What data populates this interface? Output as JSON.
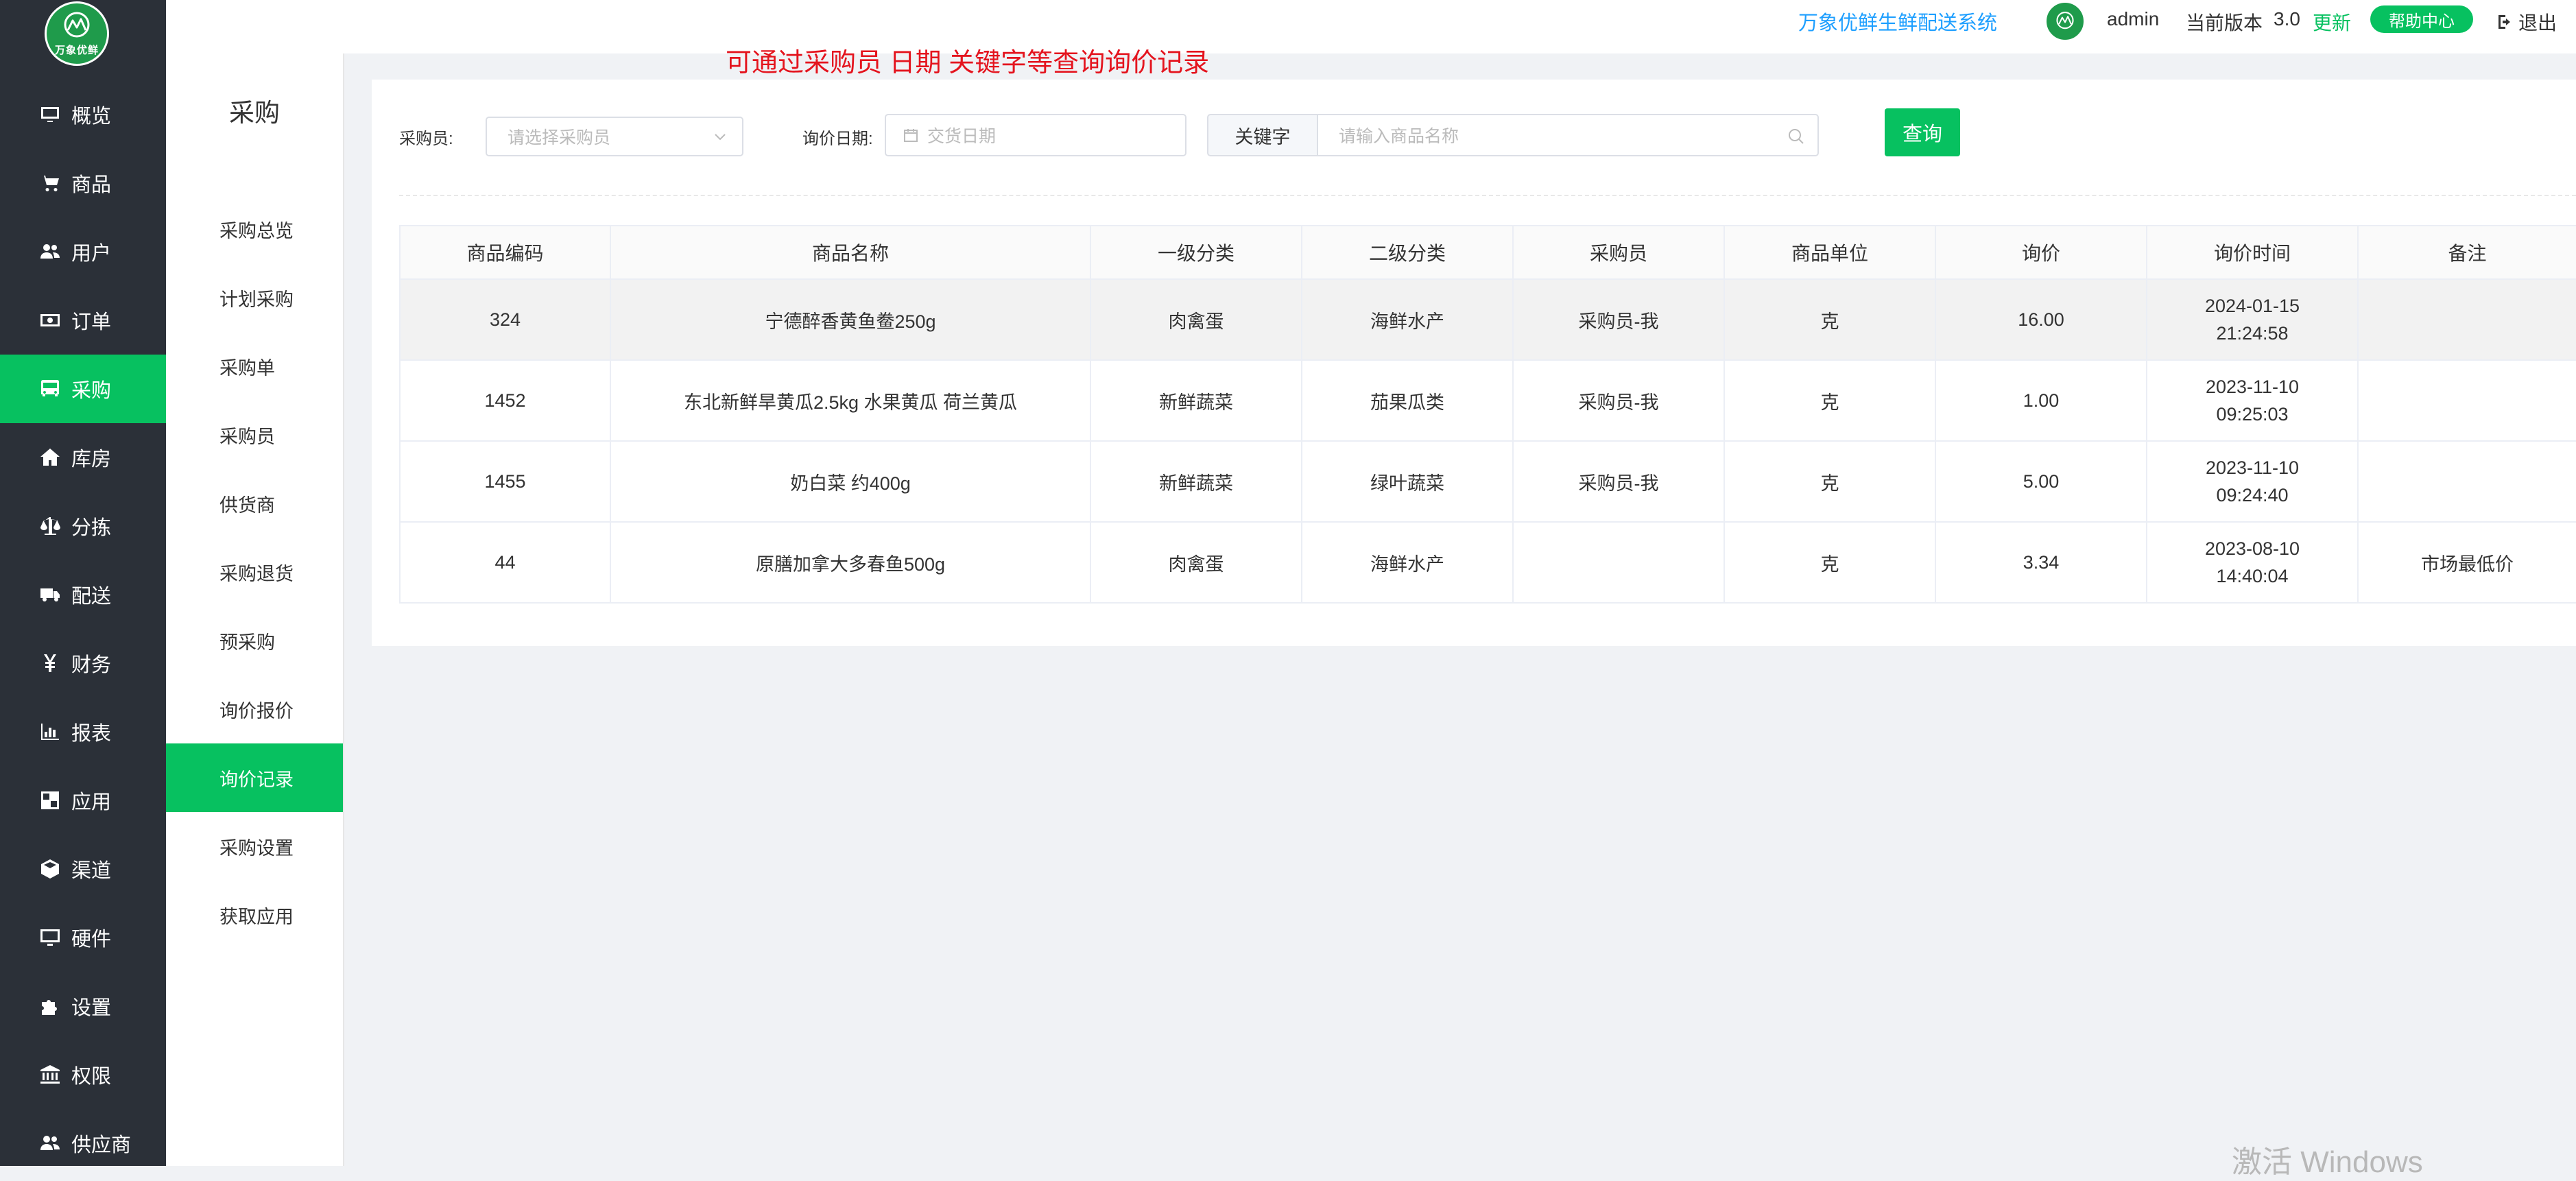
{
  "logo": {
    "text": "万象优鲜"
  },
  "nav": {
    "items": [
      {
        "label": "概览",
        "icon": "monitor-icon"
      },
      {
        "label": "商品",
        "icon": "cart-icon"
      },
      {
        "label": "用户",
        "icon": "users-icon"
      },
      {
        "label": "订单",
        "icon": "money-icon"
      },
      {
        "label": "采购",
        "icon": "bus-icon",
        "active": true
      },
      {
        "label": "库房",
        "icon": "home-icon"
      },
      {
        "label": "分拣",
        "icon": "scale-icon"
      },
      {
        "label": "配送",
        "icon": "truck-icon"
      },
      {
        "label": "财务",
        "icon": "yen-icon"
      },
      {
        "label": "报表",
        "icon": "bar-chart-icon"
      },
      {
        "label": "应用",
        "icon": "apps-icon"
      },
      {
        "label": "渠道",
        "icon": "cube-icon"
      },
      {
        "label": "硬件",
        "icon": "desktop-icon"
      },
      {
        "label": "设置",
        "icon": "puzzle-icon"
      },
      {
        "label": "权限",
        "icon": "bank-icon"
      },
      {
        "label": "供应商",
        "icon": "users-icon"
      }
    ]
  },
  "subnav": {
    "title": "采购",
    "items": [
      {
        "label": "采购总览"
      },
      {
        "label": "计划采购"
      },
      {
        "label": "采购单"
      },
      {
        "label": "采购员"
      },
      {
        "label": "供货商"
      },
      {
        "label": "采购退货"
      },
      {
        "label": "预采购"
      },
      {
        "label": "询价报价"
      },
      {
        "label": "询价记录",
        "active": true
      },
      {
        "label": "采购设置"
      },
      {
        "label": "获取应用"
      }
    ]
  },
  "header": {
    "system_name": "万象优鲜生鲜配送系统",
    "user": "admin",
    "version_label": "当前版本",
    "version": "3.0",
    "update_label": "更新",
    "help_label": "帮助中心",
    "logout_label": "退出"
  },
  "annotation": "可通过采购员 日期 关键字等查询询价记录",
  "filters": {
    "buyer_label": "采购员:",
    "buyer_placeholder": "请选择采购员",
    "date_label": "询价日期:",
    "date_placeholder": "交货日期",
    "keyword_tag": "关键字",
    "keyword_placeholder": "请输入商品名称",
    "query_label": "查询"
  },
  "table": {
    "columns": [
      "商品编码",
      "商品名称",
      "一级分类",
      "二级分类",
      "采购员",
      "商品单位",
      "询价",
      "询价时间",
      "备注"
    ],
    "rows": [
      {
        "code": "324",
        "name": "宁德醉香黄鱼鲞250g",
        "cat1": "肉禽蛋",
        "cat2": "海鲜水产",
        "buyer": "采购员-我",
        "unit": "克",
        "price": "16.00",
        "date": "2024-01-15",
        "time": "21:24:58",
        "note": ""
      },
      {
        "code": "1452",
        "name": "东北新鲜旱黄瓜2.5kg 水果黄瓜 荷兰黄瓜",
        "cat1": "新鲜蔬菜",
        "cat2": "茄果瓜类",
        "buyer": "采购员-我",
        "unit": "克",
        "price": "1.00",
        "date": "2023-11-10",
        "time": "09:25:03",
        "note": ""
      },
      {
        "code": "1455",
        "name": "奶白菜 约400g",
        "cat1": "新鲜蔬菜",
        "cat2": "绿叶蔬菜",
        "buyer": "采购员-我",
        "unit": "克",
        "price": "5.00",
        "date": "2023-11-10",
        "time": "09:24:40",
        "note": ""
      },
      {
        "code": "44",
        "name": "原膳加拿大多春鱼500g",
        "cat1": "肉禽蛋",
        "cat2": "海鲜水产",
        "buyer": "",
        "unit": "克",
        "price": "3.34",
        "date": "2023-08-10",
        "time": "14:40:04",
        "note": "市场最低价"
      }
    ]
  },
  "watermark": "激活 Windows",
  "colors": {
    "accent": "#07c160",
    "nav_bg": "#2b3038",
    "link": "#1e9fff",
    "annotation": "#e4141e"
  }
}
